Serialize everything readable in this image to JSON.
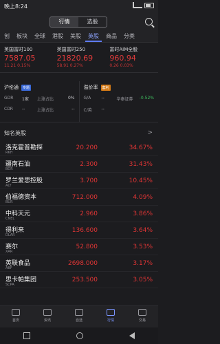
{
  "status": {
    "time": "晚上8:24"
  },
  "header": {
    "segments": [
      {
        "label": "行情",
        "active": true
      },
      {
        "label": "选股",
        "active": false
      }
    ]
  },
  "tabs": [
    "创",
    "板块",
    "全球",
    "港股",
    "美股",
    "英股",
    "商品",
    "分类"
  ],
  "active_tab": "英股",
  "indices": [
    {
      "name": "英国富时100",
      "value": "7587.05",
      "chg": "11.21 0.15%"
    },
    {
      "name": "英国富时250",
      "value": "21820.69",
      "chg": "58.91 0.27%"
    },
    {
      "name": "富时AIM全股",
      "value": "960.94",
      "chg": "0.26 0.03%"
    }
  ],
  "panels": {
    "left": {
      "title": "沪伦通",
      "badge": "专题",
      "rows": [
        {
          "c1": "GDR",
          "c2": "1家",
          "c3": "上涨占比",
          "c4": "0%"
        },
        {
          "c1": "CDR",
          "c2": "--",
          "c3": "上涨占比",
          "c4": "--"
        }
      ]
    },
    "right": {
      "title": "溢价率",
      "badge": "套利",
      "rows": [
        {
          "c1": "G/A",
          "c2": "--",
          "c3": "华泰证券",
          "c4": "-0.52%"
        },
        {
          "c1": "C/英",
          "c2": "--",
          "c3": "",
          "c4": ""
        }
      ]
    }
  },
  "section": {
    "title": "知名英股",
    "chevron": ">"
  },
  "stocks": [
    {
      "name": "洛克霍普勘探",
      "symbol": "RKH",
      "price": "20.200",
      "change": "34.67%"
    },
    {
      "name": "疆南石油",
      "symbol": "BOR",
      "price": "2.300",
      "change": "31.43%"
    },
    {
      "name": "罗兰爱思控股",
      "symbol": "ALY",
      "price": "3.700",
      "change": "10.45%"
    },
    {
      "name": "伯福德资本",
      "symbol": "BUR",
      "price": "712.000",
      "change": "4.09%"
    },
    {
      "name": "中科天元",
      "symbol": "CNEL",
      "price": "2.960",
      "change": "3.86%"
    },
    {
      "name": "得利来",
      "symbol": "DLAR",
      "price": "136.600",
      "change": "3.64%"
    },
    {
      "name": "赛尔",
      "symbol": "XAR",
      "price": "52.800",
      "change": "3.53%"
    },
    {
      "name": "英联食品",
      "symbol": "ABF",
      "price": "2698.000",
      "change": "3.17%"
    },
    {
      "name": "思卡帕集团",
      "symbol": "SCPA",
      "price": "253.500",
      "change": "3.05%"
    }
  ],
  "bottom_nav": [
    {
      "label": "首页",
      "icon": "home-icon"
    },
    {
      "label": "资讯",
      "icon": "news-icon"
    },
    {
      "label": "自选",
      "icon": "watchlist-icon"
    },
    {
      "label": "行情",
      "icon": "market-icon",
      "active": true
    },
    {
      "label": "交易",
      "icon": "trade-icon"
    }
  ]
}
